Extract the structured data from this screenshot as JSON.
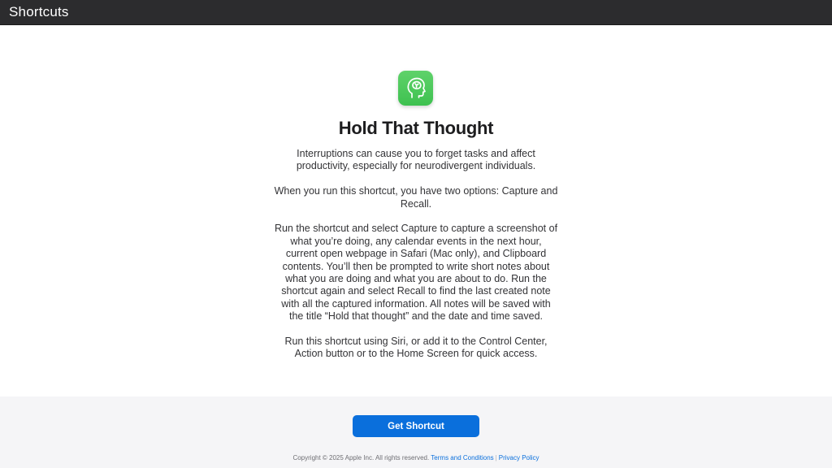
{
  "window": {
    "title": "Shortcuts"
  },
  "shortcut": {
    "icon": "head-brain-icon",
    "icon_color": "#4cc95a",
    "name": "Hold That Thought",
    "description": [
      "Interruptions can cause you to forget tasks and affect productivity, especially for neurodivergent individuals.",
      "When you run this shortcut, you have two options: Capture and Recall.",
      "Run the shortcut and select Capture to capture a screenshot of what you’re doing, any calendar events in the next hour, current open webpage in Safari (Mac only), and Clipboard contents. You’ll then be prompted to write short notes about what you are doing and what you are about to do. Run the shortcut again and select Recall to find the last created note with all the captured information. All notes will be saved with the title “Hold that thought” and the date and time saved.",
      "Run this shortcut using Siri, or add it to the Control Center, Action button or to the Home Screen for quick access."
    ]
  },
  "actions": {
    "get_label": "Get Shortcut",
    "button_color": "#0a6fdc"
  },
  "footer": {
    "copyright": "Copyright © 2025 Apple Inc. All rights reserved.",
    "terms": "Terms and Conditions",
    "separator": "|",
    "privacy": "Privacy Policy"
  }
}
